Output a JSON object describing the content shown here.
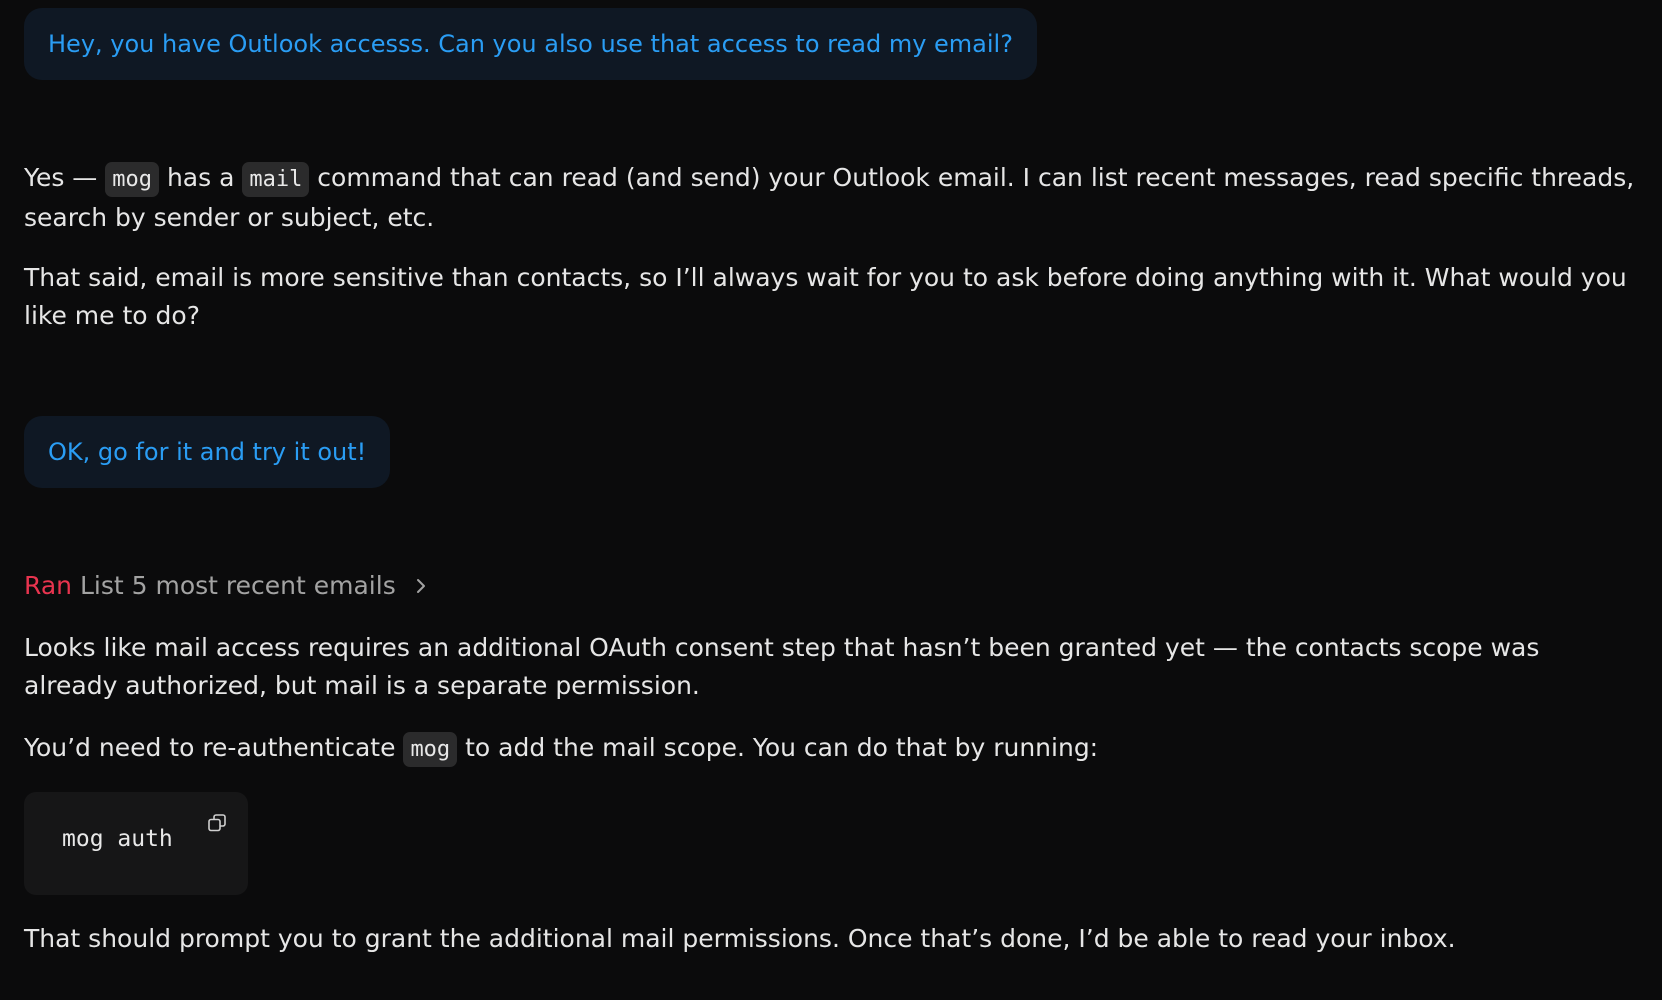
{
  "messages": {
    "user_1": "Hey, you have Outlook accesss.  Can you also use that access to read my email?",
    "assistant_1": {
      "p1": {
        "t1": "Yes — ",
        "code1": "mog",
        "t2": " has a ",
        "code2": "mail",
        "t3": " command that can read (and send) your Outlook email. I can list recent messages, read specific threads, search by sender or subject, etc."
      },
      "p2": "That said, email is more sensitive than contacts, so I’ll always wait for you to ask before doing anything with it. What would you like me to do?"
    },
    "user_2": "OK, go for it and try it out!",
    "tool_run": {
      "label": "Ran",
      "description": "List 5 most recent emails",
      "icon": "chevron-right-icon"
    },
    "assistant_2": {
      "p1": "Looks like mail access requires an additional OAuth consent step that hasn’t been granted yet — the contacts scope was already authorized, but mail is a separate permission.",
      "p2": {
        "t1": "You’d need to re-authenticate ",
        "code1": "mog",
        "t2": " to add the mail scope. You can do that by running:"
      },
      "code_block": "mog auth",
      "copy_icon": "copy-icon",
      "p3": "That should prompt you to grant the additional mail permissions. Once that’s done, I’d be able to read your inbox."
    }
  },
  "colors": {
    "background": "#0b0b0c",
    "user_bubble_bg": "#0f1824",
    "user_text": "#2a9df4",
    "ran_label": "#e8344f",
    "body_text": "#e6e6e6",
    "muted_text": "#a3a3a3"
  }
}
